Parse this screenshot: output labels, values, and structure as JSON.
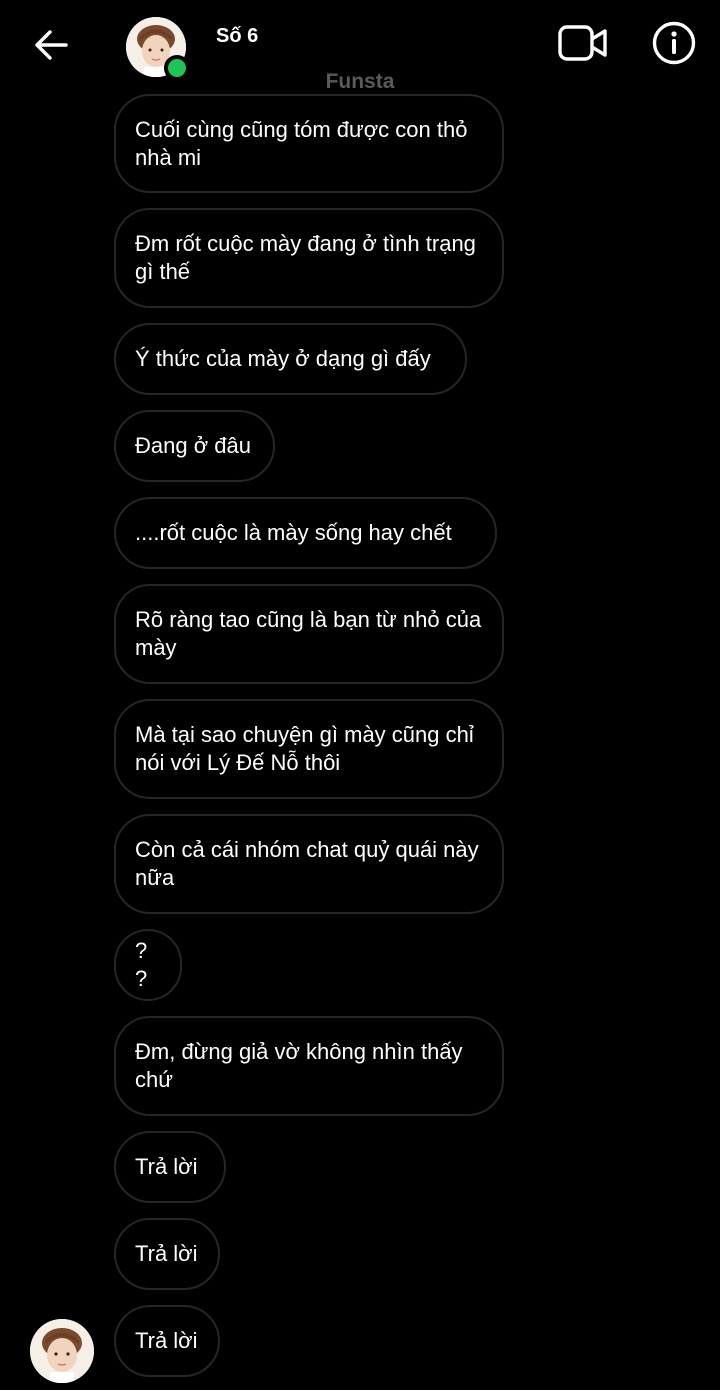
{
  "header": {
    "contact_name": "Số 6",
    "subtitle": "Funsta",
    "icons": {
      "back": "arrow-left-icon",
      "video": "video-camera-icon",
      "info": "info-icon"
    },
    "online_color": "#1fc456"
  },
  "messages": [
    {
      "text": "Cuối cùng cũng tóm được con thỏ nhà mi"
    },
    {
      "text": "Đm rốt cuộc mày đang ở tình trạng gì thế"
    },
    {
      "text": "Ý thức của mày ở dạng gì đấy"
    },
    {
      "text": "Đang ở đâu"
    },
    {
      "text": "....rốt cuộc là mày sống hay chết"
    },
    {
      "text": "Rõ ràng tao cũng là bạn từ nhỏ của mày"
    },
    {
      "text": "Mà tại sao chuyện gì mày cũng chỉ nói với Lý Đế Nỗ thôi"
    },
    {
      "text": "Còn cả cái nhóm chat quỷ quái này nữa"
    },
    {
      "text": "? ?"
    },
    {
      "text": "Đm, đừng giả vờ không nhìn thấy chứ"
    },
    {
      "text": "Trả lời"
    },
    {
      "text": "Trả lời"
    },
    {
      "text": "Trả lời"
    }
  ],
  "colors": {
    "background": "#000000",
    "bubble_border": "#262626",
    "subtitle": "#5a5a5a"
  }
}
